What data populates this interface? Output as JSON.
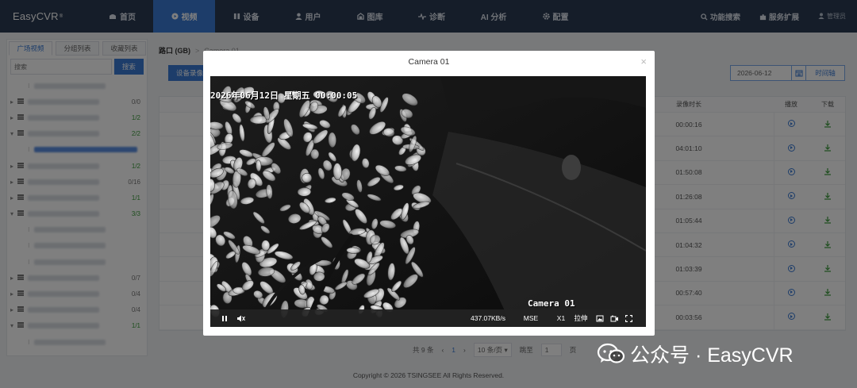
{
  "app": {
    "logo": "EasyCVR",
    "logo_mark": "®"
  },
  "nav": {
    "items": [
      {
        "label": "首页",
        "icon": "home-icon"
      },
      {
        "label": "视频",
        "icon": "video-icon",
        "active": true
      },
      {
        "label": "设备",
        "icon": "device-icon"
      },
      {
        "label": "用户",
        "icon": "user-icon"
      },
      {
        "label": "图库",
        "icon": "gallery-icon"
      },
      {
        "label": "诊断",
        "icon": "diagnose-icon"
      },
      {
        "label": "AI 分析",
        "icon": ""
      },
      {
        "label": "配置",
        "icon": "gear-icon"
      }
    ],
    "right": {
      "search": "功能搜索",
      "extensions": "服务扩展",
      "user": "管理员"
    }
  },
  "sidebar": {
    "tabs": [
      "广场视频",
      "分组列表",
      "收藏列表"
    ],
    "search_placeholder": "搜索",
    "search_button": "搜索",
    "tree": [
      {
        "count": "",
        "counted": false,
        "type": "leaf"
      },
      {
        "count": "0/0",
        "counted": false,
        "type": "group"
      },
      {
        "count": "1/2",
        "counted": true,
        "type": "group"
      },
      {
        "count": "2/2",
        "counted": true,
        "type": "group-open"
      },
      {
        "count": "",
        "counted": false,
        "type": "leaf-selected"
      },
      {
        "count": "1/2",
        "counted": true,
        "type": "group"
      },
      {
        "count": "0/16",
        "counted": false,
        "type": "group"
      },
      {
        "count": "1/1",
        "counted": true,
        "type": "group"
      },
      {
        "count": "3/3",
        "counted": true,
        "type": "group-open"
      },
      {
        "count": "",
        "counted": false,
        "type": "leaf"
      },
      {
        "count": "",
        "counted": false,
        "type": "leaf"
      },
      {
        "count": "",
        "counted": false,
        "type": "leaf"
      },
      {
        "count": "0/7",
        "counted": false,
        "type": "group"
      },
      {
        "count": "0/4",
        "counted": false,
        "type": "group"
      },
      {
        "count": "0/4",
        "counted": false,
        "type": "group"
      },
      {
        "count": "1/1",
        "counted": true,
        "type": "group-open"
      },
      {
        "count": "",
        "counted": false,
        "type": "leaf"
      }
    ]
  },
  "main": {
    "breadcrumb": {
      "parent": "路口 (GB)",
      "separator": ">",
      "current": "Camera 01"
    },
    "record_button": "设备录像",
    "date": "2026-06-12",
    "timeline_button": "时间轴",
    "table": {
      "headers": {
        "duration": "录像时长",
        "play": "播放",
        "download": "下载"
      },
      "rows": [
        "00:00:16",
        "04:01:10",
        "01:50:08",
        "01:26:08",
        "01:05:44",
        "01:04:32",
        "01:03:39",
        "00:57:40",
        "00:03:56"
      ]
    },
    "pager": {
      "total": "共 9 条",
      "prev": "‹",
      "page": "1",
      "next": "›",
      "page_size": "10 条/页",
      "jump_label": "跳至",
      "jump_value": "1",
      "page_suffix": "页"
    }
  },
  "footer": "Copyright © 2026 TSINGSEE All Rights Reserved.",
  "modal": {
    "title": "Camera 01",
    "close": "×",
    "overlay_timestamp": "2026年06月12日 星期五 00:00:05",
    "overlay_camera": "Camera 01",
    "controls": {
      "bitrate": "437.07KB/s",
      "mode": "MSE",
      "speed": "X1",
      "stretch": "拉伸"
    }
  },
  "watermark": {
    "text": "公众号 · EasyCVR",
    "icon": "wechat-icon"
  }
}
